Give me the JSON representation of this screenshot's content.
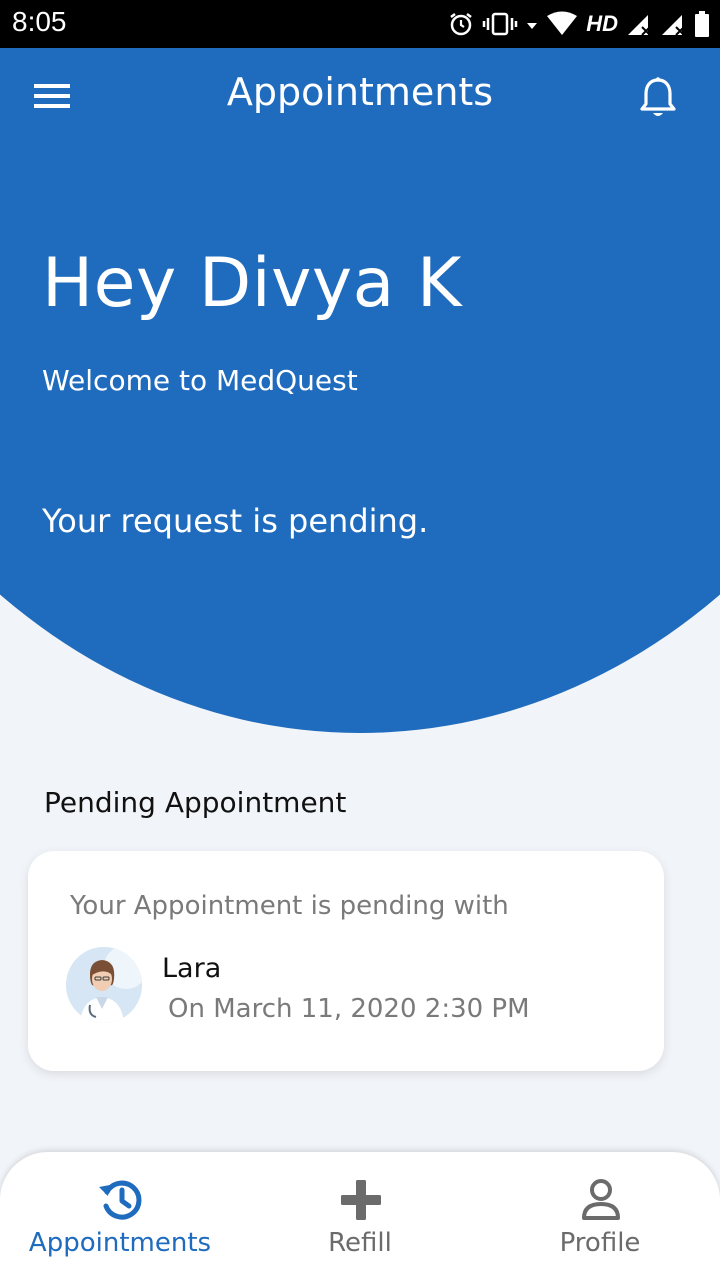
{
  "status_bar": {
    "time": "8:05",
    "network_label": "HD",
    "icons": [
      "alarm-icon",
      "vibrate-icon",
      "data-arrow-icon",
      "wifi-icon",
      "signal-icon",
      "signal-icon",
      "battery-icon"
    ]
  },
  "header": {
    "title": "Appointments",
    "menu_icon": "hamburger-menu-icon",
    "notification_icon": "bell-icon"
  },
  "hero": {
    "greeting": "Hey Divya K",
    "welcome": "Welcome to MedQuest",
    "status_message": "Your request is pending."
  },
  "pending_section": {
    "title": "Pending Appointment",
    "card": {
      "heading": "Your Appointment is pending with",
      "doctor_name": "Lara",
      "datetime": "On March 11, 2020 2:30 PM"
    }
  },
  "bottom_nav": {
    "items": [
      {
        "label": "Appointments",
        "icon": "appointment-history-icon",
        "active": true
      },
      {
        "label": "Refill",
        "icon": "plus-icon",
        "active": false
      },
      {
        "label": "Profile",
        "icon": "person-icon",
        "active": false
      }
    ]
  },
  "colors": {
    "primary": "#1f6bbd",
    "background": "#f1f4f8",
    "muted_text": "#7a7a7a"
  }
}
